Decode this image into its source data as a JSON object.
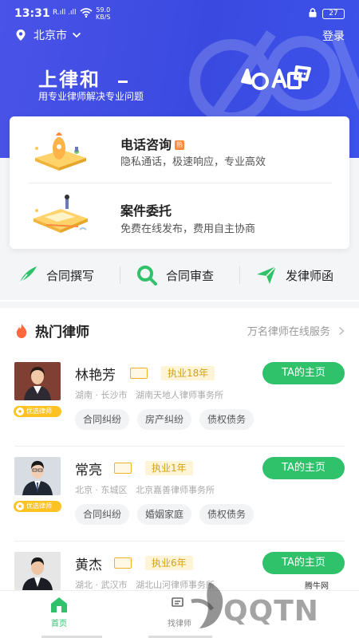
{
  "status_bar": {
    "time": "13:31",
    "signal": "R.ıll .ıll",
    "network_speed_value": "59.0",
    "network_speed_unit": "KB/S",
    "battery": "27"
  },
  "header": {
    "city": "北京市",
    "login_label": "登录",
    "brand": "上律和",
    "slogan": "用专业律师解决专业问题"
  },
  "services": [
    {
      "title": "电话咨询",
      "hot_label": "热",
      "desc": "隐私通话，极速响应，专业高效"
    },
    {
      "title": "案件委托",
      "desc": "免费在线发布，费用自主协商"
    }
  ],
  "tools": [
    {
      "label": "合同撰写",
      "icon": "feather-pen-icon"
    },
    {
      "label": "合同审查",
      "icon": "search-icon"
    },
    {
      "label": "发律师函",
      "icon": "send-icon"
    }
  ],
  "hot_lawyers": {
    "title": "热门律师",
    "more_label": "万名律师在线服务",
    "home_btn_label": "TA的主页",
    "badge_label": "优选律师",
    "items": [
      {
        "name": "林艳芳",
        "years": "执业18年",
        "region": "湖南 · 长沙市",
        "firm": "湖南天地人律师事务所",
        "tags": [
          "合同纠纷",
          "房产纠纷",
          "债权债务"
        ],
        "preferred": true
      },
      {
        "name": "常亮",
        "years": "执业1年",
        "region": "北京 · 东城区",
        "firm": "北京嘉善律师事务所",
        "tags": [
          "合同纠纷",
          "婚姻家庭",
          "债权债务"
        ],
        "preferred": true
      },
      {
        "name": "黄杰",
        "years": "执业6年",
        "region": "湖北 · 武汉市",
        "firm": "湖北山河律师事务所",
        "tags": [],
        "preferred": false
      }
    ]
  },
  "bottom_nav": [
    {
      "label": "首页",
      "active": true
    },
    {
      "label": "找律师",
      "active": false
    }
  ],
  "watermark": {
    "text": "QQTN",
    "small": "腾牛网"
  },
  "colors": {
    "banner": "#3f4ee6",
    "accent_green": "#2fc26a",
    "badge_yellow": "#ffc321",
    "years_text": "#d4a017"
  }
}
